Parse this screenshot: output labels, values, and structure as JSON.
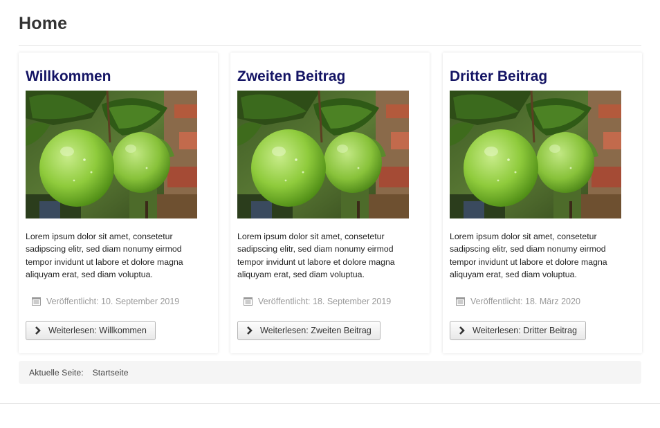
{
  "page": {
    "title": "Home"
  },
  "colors": {
    "heading": "#141464",
    "meta_text": "#999999",
    "breadcrumb_bg": "#f5f5f5"
  },
  "articles": [
    {
      "title": "Willkommen",
      "image_alt": "green-apples-photo",
      "text": "Lorem ipsum dolor sit amet, consetetur sadipscing elitr, sed diam nonumy eirmod tempor invidunt ut labore et dolore magna aliquyam erat, sed diam voluptua.",
      "published": "Veröffentlicht: 10. September 2019",
      "read_more": "Weiterlesen: Willkommen"
    },
    {
      "title": "Zweiten Beitrag",
      "image_alt": "green-apples-photo",
      "text": "Lorem ipsum dolor sit amet, consetetur sadipscing elitr, sed diam nonumy eirmod tempor invidunt ut labore et dolore magna aliquyam erat, sed diam voluptua.",
      "published": "Veröffentlicht: 18. September 2019",
      "read_more": "Weiterlesen: Zweiten Beitrag"
    },
    {
      "title": "Dritter Beitrag",
      "image_alt": "green-apples-photo",
      "text": "Lorem ipsum dolor sit amet, consetetur sadipscing elitr, sed diam nonumy eirmod tempor invidunt ut labore et dolore magna aliquyam erat, sed diam voluptua.",
      "published": "Veröffentlicht: 18. März 2020",
      "read_more": "Weiterlesen: Dritter Beitrag"
    }
  ],
  "breadcrumb": {
    "label": "Aktuelle Seite:",
    "current": "Startseite"
  },
  "icons": {
    "published": "calendar-icon",
    "read_more": "chevron-right-icon"
  }
}
